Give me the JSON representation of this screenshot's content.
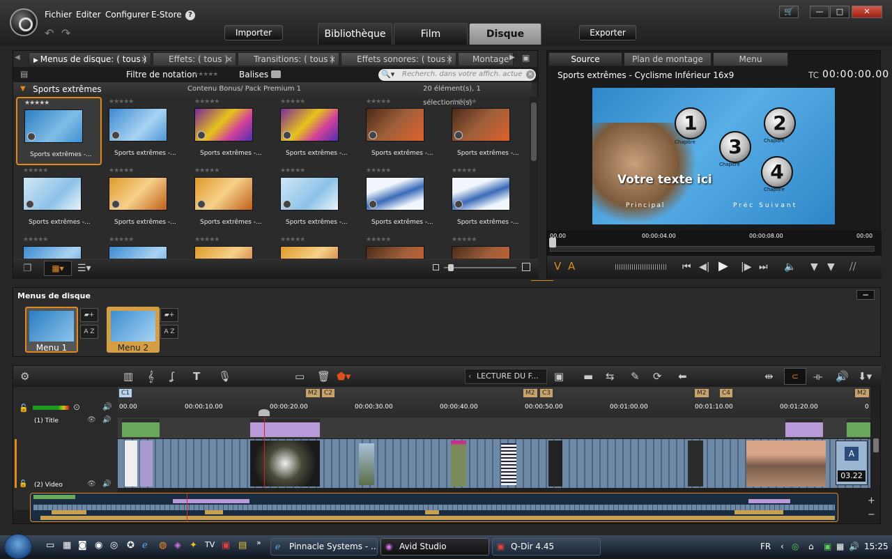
{
  "menubar": {
    "items": [
      "Fichier",
      "Editer",
      "Configurer",
      "E-Store"
    ],
    "help": "?"
  },
  "toolbar": {
    "import": "Importer",
    "export": "Exporter"
  },
  "main_tabs": [
    {
      "label": "Bibliothèque"
    },
    {
      "label": "Film"
    },
    {
      "label": "Disque",
      "active": true
    }
  ],
  "window": {
    "minimize": "—",
    "maximize": "□",
    "close": "✕"
  },
  "library": {
    "tabs": [
      {
        "label": "Menus de disque: ( tous )",
        "active": true
      },
      {
        "label": "Effets: ( tous )"
      },
      {
        "label": "Transitions: ( tous )"
      },
      {
        "label": "Effets sonores: ( tous )"
      },
      {
        "label": "Montage"
      }
    ],
    "close_glyph": "×",
    "rating_filter_label": "Filtre de notation",
    "tags_label": "Balises",
    "search_placeholder": "Recherch. dans votre affich. actue",
    "group": {
      "title": "Sports extrêmes",
      "subtitle": "Contenu Bonus/ Pack Premium 1",
      "count": "20 élément(s), 1 sélectionné(s)"
    },
    "item_caption": "Sports extrêmes -...",
    "items": [
      {
        "theme": "blue-numbers",
        "selected": true
      },
      {
        "theme": "blue-text"
      },
      {
        "theme": "purple-yellow"
      },
      {
        "theme": "purple-yellow"
      },
      {
        "theme": "brown-orange"
      },
      {
        "theme": "brown-orange"
      },
      {
        "theme": "light-blue"
      },
      {
        "theme": "orange"
      },
      {
        "theme": "orange"
      },
      {
        "theme": "light-blue"
      },
      {
        "theme": "blue-wave"
      },
      {
        "theme": "blue-wave"
      }
    ]
  },
  "preview": {
    "tabs": [
      {
        "label": "Source",
        "active": true
      },
      {
        "label": "Plan de montage"
      },
      {
        "label": "Menu"
      }
    ],
    "title": "Sports extrêmes - Cyclisme Inférieur 16x9",
    "tc_label": "TC",
    "timecode": "00:00:00.00",
    "screen": {
      "chapters": [
        "1",
        "2",
        "3",
        "4"
      ],
      "chapter_label": "Chapitre",
      "text": "Votre texte ici",
      "nav_main": "Principal",
      "nav_prev_next": "Préc Suivant"
    },
    "ruler": [
      "00.00",
      "00:00:04.00",
      "00:00:08.00",
      "00:00"
    ],
    "va": [
      "V",
      "A"
    ]
  },
  "disc_menus": {
    "title": "Menus de disque",
    "collapse": "−",
    "menus": [
      {
        "label": "Menu 1",
        "active": true
      },
      {
        "label": "Menu 2"
      }
    ],
    "az": "A Z"
  },
  "timeline": {
    "play_label": "LECTURE DU F...",
    "chapter_c1": "C1",
    "markers": [
      {
        "m": "M2",
        "c": "C2"
      },
      {
        "m": "M2",
        "c": "C3"
      },
      {
        "m": "M2",
        "c": "C4"
      },
      {
        "m": "M2",
        "c": ""
      }
    ],
    "ruler": [
      "00.00",
      "00:00:10.00",
      "00:00:20.00",
      "00:00:30.00",
      "00:00:40.00",
      "00:00:50.00",
      "00:01:00.00",
      "00:01:10.00",
      "00:01:20.00",
      "0"
    ],
    "tracks": [
      {
        "label": "(1) Title"
      },
      {
        "label": "(2) Video"
      }
    ],
    "clip_badge": "A",
    "clip_time": "03.22"
  },
  "taskbar": {
    "tasks": [
      {
        "label": "Pinnacle Systems - ..."
      },
      {
        "label": "Avid Studio",
        "active": true
      },
      {
        "label": "Q-Dir 4.45"
      }
    ],
    "lang": "FR",
    "clock": "15:25"
  }
}
